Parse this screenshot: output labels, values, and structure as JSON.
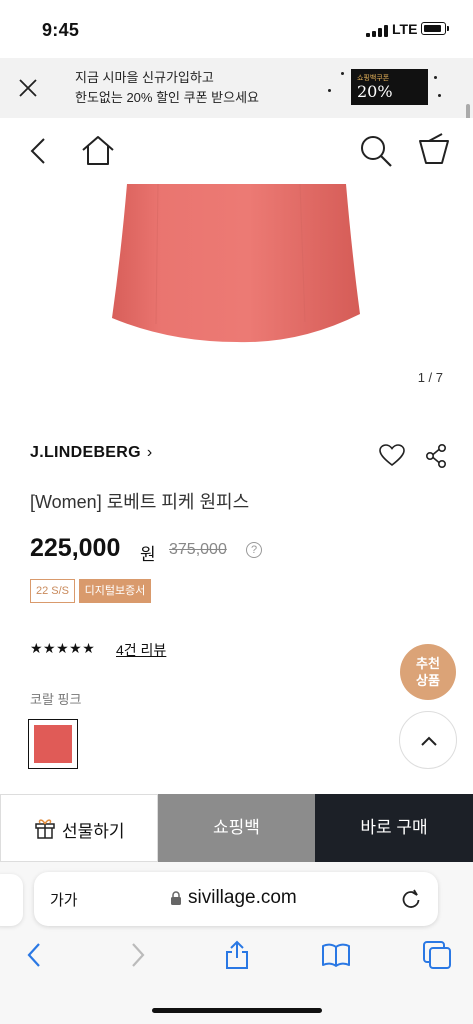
{
  "status_bar": {
    "time": "9:45",
    "network": "LTE"
  },
  "promo": {
    "line1": "지금 시마을 신규가입하고",
    "line2": "한도없는 20% 할인 쿠폰 받으세요",
    "coupon_small": "쇼핑백쿠폰",
    "coupon_big": "20%"
  },
  "product": {
    "image_counter": "1 / 7",
    "brand": "J.LINDEBERG",
    "name": "[Women] 로베트 피케 원피스",
    "price": "225,000",
    "currency": "원",
    "original_price": "375,000",
    "badges": {
      "season": "22 S/S",
      "certificate": "디지털보증서"
    },
    "stars": "★★★★★",
    "review_link": "4건 리뷰",
    "color_label": "코랄 핑크",
    "swatch_color": "#e05b57",
    "dress_color": "#e8716c"
  },
  "floating": {
    "recommend_line1": "추천",
    "recommend_line2": "상품"
  },
  "actions": {
    "gift": "선물하기",
    "shopping_bag": "쇼핑백",
    "buy_now": "바로 구매"
  },
  "browser": {
    "text_size": "가가",
    "url": "sivillage.com"
  },
  "colors": {
    "accent": "#dba377",
    "dark": "#1c2027",
    "gray_button": "#8c8c8c"
  }
}
